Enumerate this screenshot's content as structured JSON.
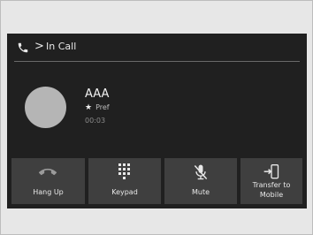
{
  "header": {
    "chevron": ">",
    "title": "In Call"
  },
  "contact": {
    "name": "AAA",
    "pref_label": "Pref",
    "timer": "00:03"
  },
  "buttons": [
    {
      "label": "Hang Up",
      "icon": "hang-up-icon"
    },
    {
      "label": "Keypad",
      "icon": "keypad-icon"
    },
    {
      "label": "Mute",
      "icon": "mute-icon"
    },
    {
      "label": "Transfer to Mobile",
      "icon": "transfer-icon"
    }
  ],
  "colors": {
    "screen_bg": "#202020",
    "button_bg": "#3f3f3f",
    "text": "#e8e8e8",
    "avatar": "#b5b5b5",
    "frame": "#e7e7e7"
  }
}
